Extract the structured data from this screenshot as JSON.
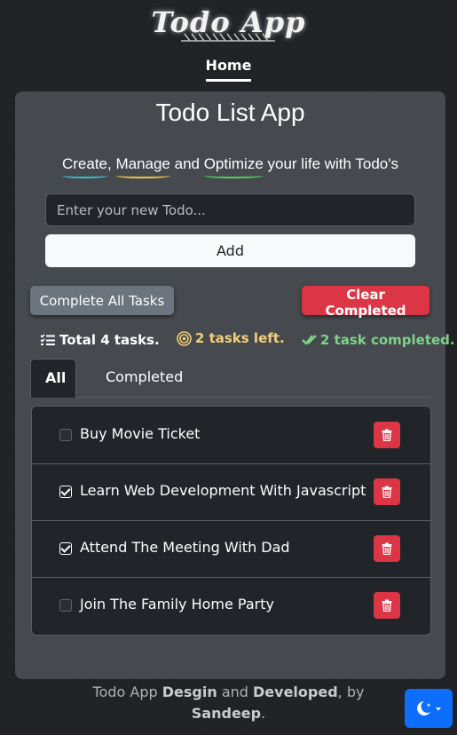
{
  "brand": {
    "logo_text": "Todo App"
  },
  "nav": {
    "home": "Home"
  },
  "card": {
    "title": "Todo List App",
    "tagline": {
      "w1": "Create",
      "sep1": ", ",
      "w2": "Manage",
      "sep2": " and ",
      "w3": "Optimize",
      "rest": " your life with Todo's",
      "underline_colors": [
        "#39c0d4",
        "#f3c74d",
        "#4fd65c"
      ]
    },
    "input_placeholder": "Enter your new Todo...",
    "add_label": "Add",
    "complete_all_label": "Complete All Tasks",
    "clear_completed_label": "Clear Completed"
  },
  "stats": {
    "total": "Total 4 tasks.",
    "left": "2 tasks left.",
    "completed": "2 task completed."
  },
  "tabs": [
    {
      "label": "All",
      "active": true
    },
    {
      "label": "Completed",
      "active": false
    }
  ],
  "todos": [
    {
      "text": "Buy Movie Ticket",
      "completed": false
    },
    {
      "text": "Learn Web Development With Javascript",
      "completed": true
    },
    {
      "text": "Attend The Meeting With Dad",
      "completed": true
    },
    {
      "text": "Join The Family Home Party",
      "completed": false
    }
  ],
  "footer": {
    "p1": "Todo App ",
    "b1": "Desgin",
    "p2": " and ",
    "b2": "Developed",
    "p3": ", by",
    "b3": "Sandeep",
    "p4": "."
  },
  "icons": {
    "list": "list-check-icon",
    "pending": "target-icon",
    "done": "double-check-icon",
    "delete": "trash-icon",
    "theme": "moon-stars-icon"
  },
  "colors": {
    "accent": "#0d6efd",
    "danger": "#dc3545",
    "secondary": "#6c757d",
    "pending": "#f3cf78",
    "done": "#7fd18c"
  }
}
